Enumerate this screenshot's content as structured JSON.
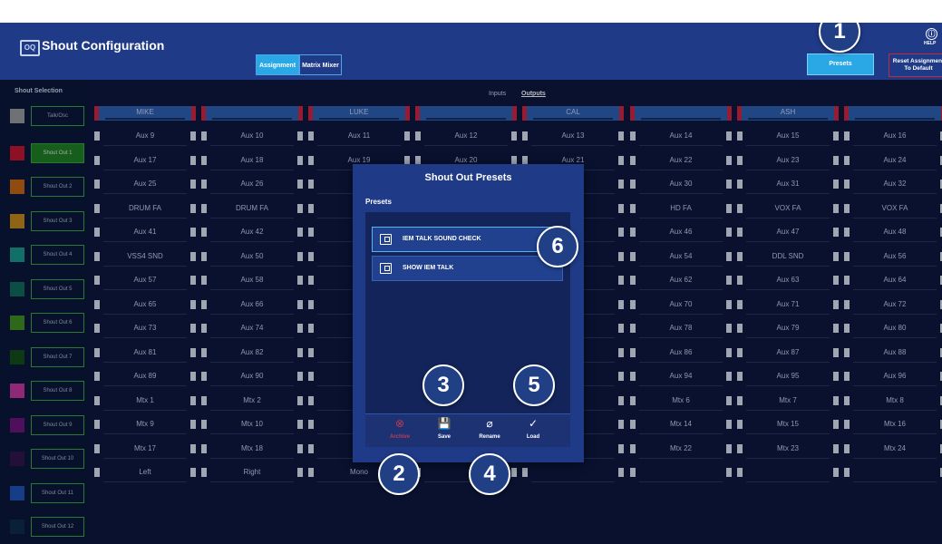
{
  "app": {
    "title": "Shout Configuration",
    "logo_text": "OQ",
    "tabs": [
      "Assignment",
      "Matrix Mixer"
    ],
    "presets_button": "Presets",
    "reset_button_line1": "Reset Assignment",
    "reset_button_line2": "To Default",
    "help_label": "HELP",
    "help_icon_glyph": "ⓘ"
  },
  "sidebar": {
    "title": "Shout Selection",
    "items": [
      {
        "label": "Talk/Osc",
        "color": "#9a9a9a",
        "active": false
      },
      {
        "label": "Shout Out 1",
        "color": "#c4142a",
        "active": true
      },
      {
        "label": "Shout Out 2",
        "color": "#c7660f",
        "active": false
      },
      {
        "label": "Shout Out 3",
        "color": "#c28a12",
        "active": false
      },
      {
        "label": "Shout Out 4",
        "color": "#179886",
        "active": false
      },
      {
        "label": "Shout Out 5",
        "color": "#0f6a55",
        "active": false
      },
      {
        "label": "Shout Out 6",
        "color": "#3f8f1c",
        "active": false
      },
      {
        "label": "Shout Out 7",
        "color": "#124d14",
        "active": false
      },
      {
        "label": "Shout Out 8",
        "color": "#c2369c",
        "active": false
      },
      {
        "label": "Shout Out 9",
        "color": "#6c1276",
        "active": false
      },
      {
        "label": "Shout Out 10",
        "color": "#2e1347",
        "active": false
      },
      {
        "label": "Shout Out 11",
        "color": "#1d54b2",
        "active": false
      },
      {
        "label": "Shout Out 12",
        "color": "#0d2a45",
        "active": false
      }
    ]
  },
  "io_tabs": {
    "inputs": "Inputs",
    "outputs": "Outputs",
    "selected": "outputs"
  },
  "channel_headers": [
    "MIKE",
    "",
    "LUKE",
    "",
    "CAL",
    "",
    "ASH",
    ""
  ],
  "grid_rows": [
    [
      "Aux 9",
      "Aux 10",
      "Aux 11",
      "Aux 12",
      "Aux 13",
      "Aux 14",
      "Aux 15",
      "Aux 16"
    ],
    [
      "Aux 17",
      "Aux 18",
      "Aux 19",
      "Aux 20",
      "Aux 21",
      "Aux 22",
      "Aux 23",
      "Aux 24"
    ],
    [
      "Aux 25",
      "Aux 26",
      "",
      "",
      "",
      "Aux 30",
      "Aux 31",
      "Aux 32"
    ],
    [
      "DRUM FA",
      "DRUM FA",
      "",
      "",
      "",
      "HD FA",
      "VOX FA",
      "VOX FA"
    ],
    [
      "Aux 41",
      "Aux 42",
      "",
      "",
      "",
      "Aux 46",
      "Aux 47",
      "Aux 48"
    ],
    [
      "VSS4 SND",
      "Aux 50",
      "",
      "",
      "",
      "Aux 54",
      "DDL SND",
      "Aux 56"
    ],
    [
      "Aux 57",
      "Aux 58",
      "",
      "",
      "",
      "Aux 62",
      "Aux 63",
      "Aux 64"
    ],
    [
      "Aux 65",
      "Aux 66",
      "",
      "",
      "",
      "Aux 70",
      "Aux 71",
      "Aux 72"
    ],
    [
      "Aux 73",
      "Aux 74",
      "",
      "",
      "",
      "Aux 78",
      "Aux 79",
      "Aux 80"
    ],
    [
      "Aux 81",
      "Aux 82",
      "",
      "",
      "",
      "Aux 86",
      "Aux 87",
      "Aux 88"
    ],
    [
      "Aux 89",
      "Aux 90",
      "",
      "",
      "",
      "Aux 94",
      "Aux 95",
      "Aux 96"
    ],
    [
      "Mtx 1",
      "Mtx 2",
      "",
      "",
      "",
      "Mtx 6",
      "Mtx 7",
      "Mtx 8"
    ],
    [
      "Mtx 9",
      "Mtx 10",
      "",
      "",
      "",
      "Mtx 14",
      "Mtx 15",
      "Mtx 16"
    ],
    [
      "Mtx 17",
      "Mtx 18",
      "",
      "",
      "",
      "Mtx 22",
      "Mtx 23",
      "Mtx 24"
    ],
    [
      "Left",
      "Right",
      "Mono",
      "",
      "",
      "",
      "",
      ""
    ]
  ],
  "modal": {
    "title": "Shout Out Presets",
    "section_label": "Presets",
    "presets": [
      "IEM TALK SOUND CHECK",
      "SHOW IEM TALK"
    ],
    "selected_index": 0,
    "toolbar": [
      {
        "label": "Archive",
        "icon": "archive-icon",
        "glyph": "⊗",
        "disabled": true
      },
      {
        "label": "Save",
        "icon": "save-icon",
        "glyph": "💾",
        "disabled": false
      },
      {
        "label": "Rename",
        "icon": "rename-icon",
        "glyph": "⌀",
        "disabled": false
      },
      {
        "label": "Load",
        "icon": "load-icon",
        "glyph": "✓",
        "disabled": false
      }
    ]
  },
  "callouts": [
    "1",
    "2",
    "3",
    "4",
    "5",
    "6"
  ]
}
